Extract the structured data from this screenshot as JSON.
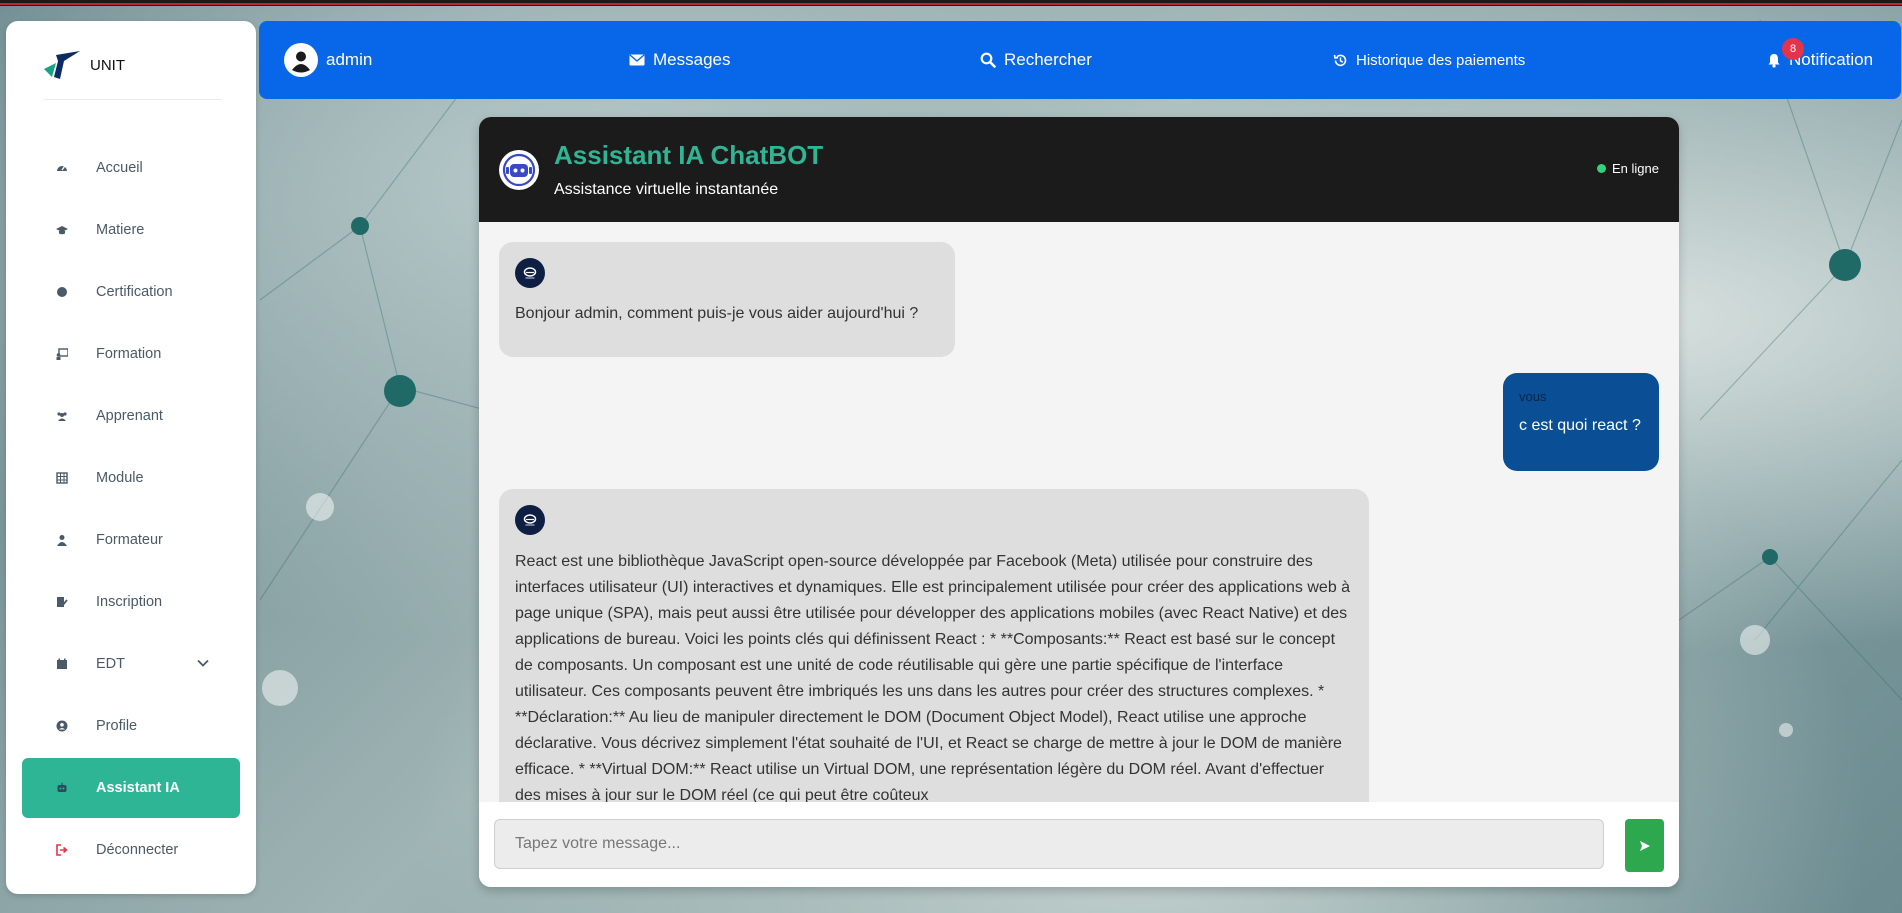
{
  "brand": {
    "name": "UNIT"
  },
  "sidebar": {
    "items": [
      {
        "label": "Accueil",
        "icon": "dashboard-icon"
      },
      {
        "label": "Matiere",
        "icon": "graduation-cap-icon"
      },
      {
        "label": "Certification",
        "icon": "certificate-icon"
      },
      {
        "label": "Formation",
        "icon": "chalkboard-teacher-icon"
      },
      {
        "label": "Apprenant",
        "icon": "users-icon"
      },
      {
        "label": "Module",
        "icon": "table-icon"
      },
      {
        "label": "Formateur",
        "icon": "user-icon"
      },
      {
        "label": "Inscription",
        "icon": "signature-icon"
      },
      {
        "label": "EDT",
        "icon": "calendar-icon"
      },
      {
        "label": "Profile",
        "icon": "user-circle-icon"
      },
      {
        "label": "Assistant IA",
        "icon": "robot-icon",
        "active": true
      },
      {
        "label": "Déconnecter",
        "icon": "logout-icon"
      }
    ]
  },
  "topbar": {
    "user": "admin",
    "messages": "Messages",
    "search": "Rechercher",
    "history": "Historique des paiements",
    "notification": "Notification",
    "notification_count": "8"
  },
  "chat": {
    "title": "Assistant IA ChatBOT",
    "subtitle": "Assistance virtuelle instantanée",
    "status": "En ligne",
    "messages": [
      {
        "sender": "bot",
        "text": "Bonjour admin, comment puis-je vous aider aujourd'hui ?"
      },
      {
        "sender": "user",
        "label": "vous",
        "text": "c est quoi react ?"
      },
      {
        "sender": "bot",
        "text": "React est une bibliothèque JavaScript open-source développée par Facebook (Meta) utilisée pour construire des interfaces utilisateur (UI) interactives et dynamiques. Elle est principalement utilisée pour créer des applications web à page unique (SPA), mais peut aussi être utilisée pour développer des applications mobiles (avec React Native) et des applications de bureau. Voici les points clés qui définissent React : * **Composants:** React est basé sur le concept de composants. Un composant est une unité de code réutilisable qui gère une partie spécifique de l'interface utilisateur. Ces composants peuvent être imbriqués les uns dans les autres pour créer des structures complexes. * **Déclaration:** Au lieu de manipuler directement le DOM (Document Object Model), React utilise une approche déclarative. Vous décrivez simplement l'état souhaité de l'UI, et React se charge de mettre à jour le DOM de manière efficace. * **Virtual DOM:** React utilise un Virtual DOM, une représentation légère du DOM réel. Avant d'effectuer des mises à jour sur le DOM réel (ce qui peut être coûteux"
      }
    ],
    "input_placeholder": "Tapez votre message...",
    "send_icon": "send-icon"
  },
  "colors": {
    "primary": "#0866e8",
    "accent": "#2db595",
    "header": "#1b1b1b",
    "user_bubble": "#0a4f95",
    "bot_bubble": "#dedede",
    "online": "#2ed37c",
    "send": "#2ea84f",
    "badge": "#e3344b"
  }
}
